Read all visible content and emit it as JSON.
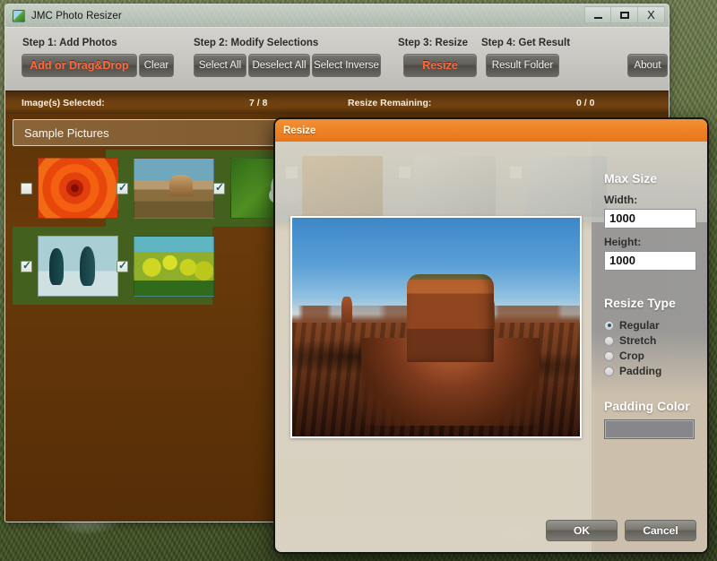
{
  "window": {
    "title": "JMC Photo Resizer",
    "icon": "app-icon",
    "minimize": "–",
    "maximize": "□",
    "close": "X"
  },
  "toolbar": {
    "steps": [
      {
        "label": "Step 1: Add Photos"
      },
      {
        "label": "Step 2: Modify Selections"
      },
      {
        "label": "Step 3: Resize"
      },
      {
        "label": "Step 4: Get Result"
      }
    ],
    "add_button": "Add or Drag&Drop",
    "clear_button": "Clear",
    "select_all_button": "Select All",
    "deselect_all_button": "Deselect All",
    "select_inverse_button": "Select Inverse",
    "resize_button": "Resize",
    "result_folder_button": "Result Folder",
    "about_button": "About"
  },
  "status": {
    "images_selected_label": "Image(s) Selected:",
    "images_selected_value": "7 / 8",
    "resize_remaining_label": "Resize Remaining:",
    "resize_remaining_value": "0 / 0"
  },
  "gallery": {
    "group_label": "Sample Pictures",
    "thumbnails": [
      {
        "name": "flower",
        "checked": false
      },
      {
        "name": "butte",
        "checked": true
      },
      {
        "name": "hydrangea",
        "checked": true
      },
      {
        "name": "penguins",
        "checked": true
      },
      {
        "name": "tulips",
        "checked": true
      }
    ]
  },
  "dialog": {
    "title": "Resize",
    "max_size_heading": "Max Size",
    "width_label": "Width:",
    "width_value": "1000",
    "height_label": "Height:",
    "height_value": "1000",
    "resize_type_heading": "Resize Type",
    "resize_types": [
      {
        "label": "Regular",
        "selected": true
      },
      {
        "label": "Stretch",
        "selected": false
      },
      {
        "label": "Crop",
        "selected": false
      },
      {
        "label": "Padding",
        "selected": false
      }
    ],
    "padding_color_heading": "Padding Color",
    "padding_color_value": "#87878b",
    "ok_button": "OK",
    "cancel_button": "Cancel",
    "preview_alt": "desert butte photo preview"
  },
  "colors": {
    "dialog_title_bar": "#ef8526",
    "accent_orange": "#ff6a3c",
    "status_bar_brown": "#6d3f11",
    "gallery_brown": "#5d3308",
    "thumb_row_green": "#44601f"
  }
}
